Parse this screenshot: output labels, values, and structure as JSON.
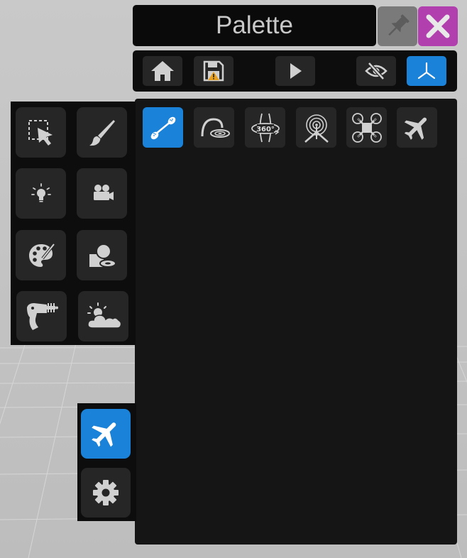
{
  "window": {
    "title": "Palette"
  },
  "title_buttons": [
    {
      "name": "pin",
      "icon": "pin-icon"
    },
    {
      "name": "close",
      "icon": "close-icon"
    }
  ],
  "toolbar": {
    "buttons": [
      {
        "name": "home",
        "icon": "home-icon",
        "active": false
      },
      {
        "name": "save",
        "icon": "save-warning-icon",
        "active": false
      },
      {
        "name": "play",
        "icon": "play-icon",
        "active": false
      },
      {
        "name": "visibility",
        "icon": "eye-off-icon",
        "active": false
      },
      {
        "name": "axes",
        "icon": "axes-icon",
        "active": true
      }
    ]
  },
  "tools": [
    {
      "name": "stroke-tool",
      "icon": "stroke-connector-icon",
      "active": true
    },
    {
      "name": "drop-tool",
      "icon": "drop-target-icon",
      "active": false
    },
    {
      "name": "orbit-360",
      "icon": "rotate-360-icon",
      "active": false
    },
    {
      "name": "tripod",
      "icon": "tripod-target-icon",
      "active": false
    },
    {
      "name": "drone",
      "icon": "drone-icon",
      "active": false
    },
    {
      "name": "airplane",
      "icon": "airplane-icon",
      "active": false
    }
  ],
  "left_panel": [
    {
      "name": "select",
      "icon": "select-cursor-icon"
    },
    {
      "name": "brush",
      "icon": "brush-icon"
    },
    {
      "name": "light",
      "icon": "lightbulb-icon"
    },
    {
      "name": "camera",
      "icon": "movie-camera-icon"
    },
    {
      "name": "material",
      "icon": "palette-icon"
    },
    {
      "name": "objects",
      "icon": "shapes-icon"
    },
    {
      "name": "ray-gun",
      "icon": "ray-gun-icon"
    },
    {
      "name": "environment",
      "icon": "weather-icon"
    }
  ],
  "bottom_panel": [
    {
      "name": "fly-mode",
      "icon": "airplane-icon",
      "active": true
    },
    {
      "name": "settings",
      "icon": "gear-icon",
      "active": false
    }
  ],
  "colors": {
    "accent": "#1a82d8",
    "close": "#b23fae",
    "pin": "#7a7a7a",
    "panel": "#151515",
    "button": "#262626",
    "icon": "#d0d0d0"
  }
}
